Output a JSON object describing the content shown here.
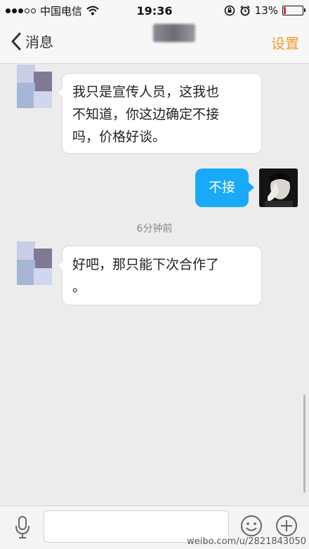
{
  "status_bar": {
    "carrier": "中国电信",
    "time": "19:36",
    "battery": "13%",
    "battery_level": 0.13,
    "icons": [
      "signal-icon",
      "wifi-icon",
      "rotation-lock-icon",
      "alarm-icon",
      "battery-icon"
    ]
  },
  "nav": {
    "back_label": "消息",
    "settings_label": "设置",
    "accent": "#f19a2b"
  },
  "messages": [
    {
      "side": "in",
      "text_lines": [
        "我只是宣传人员，这我也",
        "不知道，你这边确定不接",
        "吗，价格好谈。"
      ]
    },
    {
      "side": "out",
      "text": "不接"
    },
    {
      "side": "in",
      "text_lines": [
        "好吧，那只能下次合作了",
        "。"
      ]
    }
  ],
  "timestamp": "6分钟前",
  "colors": {
    "outgoing_bubble": "#18aaf8",
    "background": "#ececec"
  },
  "watermark": "weibo.com/u/2821843050"
}
